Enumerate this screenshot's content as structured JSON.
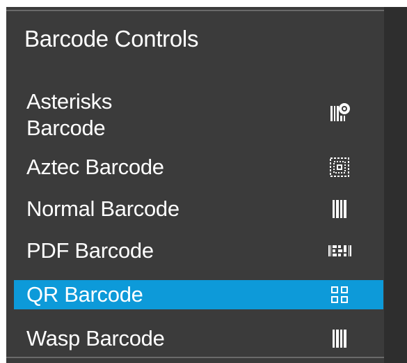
{
  "panel": {
    "title": "Barcode Controls",
    "items": [
      {
        "label_line1": "Asterisks",
        "label_line2": "Barcode",
        "icon": "asterisks-barcode-icon",
        "selected": false
      },
      {
        "label": "Aztec Barcode",
        "icon": "aztec-barcode-icon",
        "selected": false
      },
      {
        "label": "Normal Barcode",
        "icon": "normal-barcode-icon",
        "selected": false
      },
      {
        "label": "PDF Barcode",
        "icon": "pdf-barcode-icon",
        "selected": false
      },
      {
        "label": "QR Barcode",
        "icon": "qr-barcode-icon",
        "selected": true
      },
      {
        "label": "Wasp Barcode",
        "icon": "wasp-barcode-icon",
        "selected": false
      }
    ]
  },
  "colors": {
    "panel_background": "#3b3b3b",
    "selection": "#0d9ad9",
    "text": "#ffffff"
  }
}
